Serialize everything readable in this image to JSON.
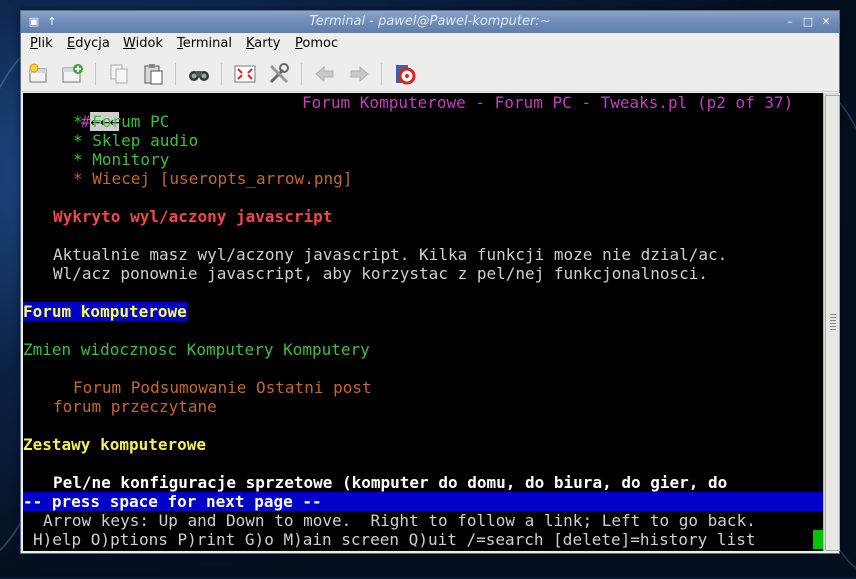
{
  "window": {
    "title": "Terminal - pawel@Pawel-komputer:~"
  },
  "menu": [
    "Plik",
    "Edycja",
    "Widok",
    "Terminal",
    "Karty",
    "Pomoc"
  ],
  "toolbar": {
    "icons": [
      "new-tab-icon",
      "new-window-icon",
      "copy-icon",
      "paste-icon",
      "find-icon",
      "fullscreen-icon",
      "preferences-icon",
      "back-icon",
      "forward-icon",
      "help-icon"
    ]
  },
  "terminal": {
    "prompt_mark": "#",
    "cursor_keys": "←←←",
    "page_header": "Forum Komputerowe - Forum PC - Tweaks.pl (p2 of 37)",
    "nav_items": [
      "* Forum PC",
      "* Sklep audio",
      "* Monitory",
      "* Wiecej [useropts_arrow.png]"
    ],
    "js_heading": "Wykryto wyl/aczony javascript",
    "js_line1": "Aktualnie masz wyl/aczony javascript. Kilka funkcji moze nie dzial/ac.",
    "js_line2": "Wl/acz ponownie javascript, aby korzystac z pel/nej funkcjonalnosci.",
    "forum_heading": "Forum komputerowe",
    "visibility_link": "Zmien widocznosc Komputery Komputery",
    "columns_line": "Forum Podsumowanie Ostatni post",
    "read_link": "forum przeczytane",
    "section_heading": "Zestawy komputerowe",
    "section_desc": "Pel/ne konfiguracje sprzetowe (komputer do domu, do biura, do gier, do",
    "status": "-- press space for next page --",
    "help1": "Arrow keys: Up and Down to move.  Right to follow a link; Left to go back.",
    "help2": "H)elp O)ptions P)rint G)o M)ain screen Q)uit /=search [delete]=history list"
  },
  "colors": {
    "title_bar": "#6f8db8",
    "terminal_bg": "#000000",
    "link_green": "#3fbf3f",
    "header_magenta": "#c23fbf",
    "status_blue": "#0000c8",
    "cursor_green": "#00c400"
  }
}
